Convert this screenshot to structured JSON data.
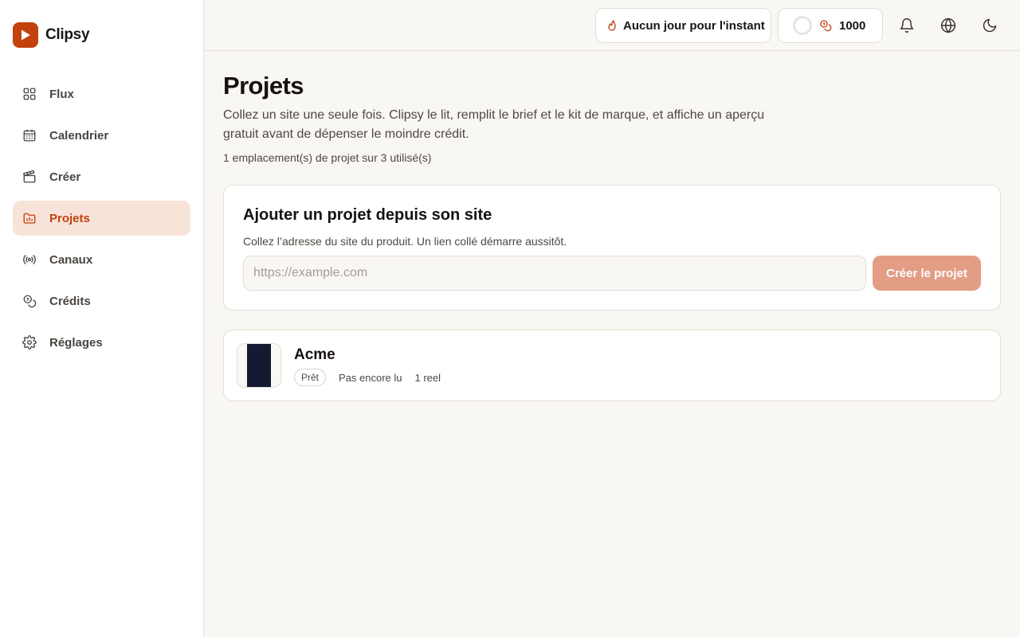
{
  "app": {
    "name": "Clipsy",
    "accent": "#c2410c"
  },
  "sidebar": {
    "items": [
      {
        "label": "Flux",
        "icon": "grid-icon",
        "active": false
      },
      {
        "label": "Calendrier",
        "icon": "calendar-icon",
        "active": false
      },
      {
        "label": "Créer",
        "icon": "clapperboard-icon",
        "active": false
      },
      {
        "label": "Projets",
        "icon": "folder-icon",
        "active": true
      },
      {
        "label": "Canaux",
        "icon": "broadcast-icon",
        "active": false
      },
      {
        "label": "Crédits",
        "icon": "coins-icon",
        "active": false
      },
      {
        "label": "Réglages",
        "icon": "gear-icon",
        "active": false
      }
    ]
  },
  "topbar": {
    "streak_label": "Aucun jour pour l'instant",
    "credits": "1000"
  },
  "page": {
    "title": "Projets",
    "description": "Collez un site une seule fois. Clipsy le lit, remplit le brief et le kit de marque, et affiche un aperçu gratuit avant de dépenser le moindre crédit.",
    "slots_text": "1 emplacement(s) de projet sur 3 utilisé(s)"
  },
  "add_project": {
    "title": "Ajouter un projet depuis son site",
    "subtitle": "Collez l’adresse du site du produit. Un lien collé démarre aussitôt.",
    "input_value": "",
    "input_placeholder": "https://example.com",
    "button_label": "Créer le projet"
  },
  "projects": [
    {
      "name": "Acme",
      "status": "Prêt",
      "read_status": "Pas encore lu",
      "reels": "1 reel"
    }
  ]
}
